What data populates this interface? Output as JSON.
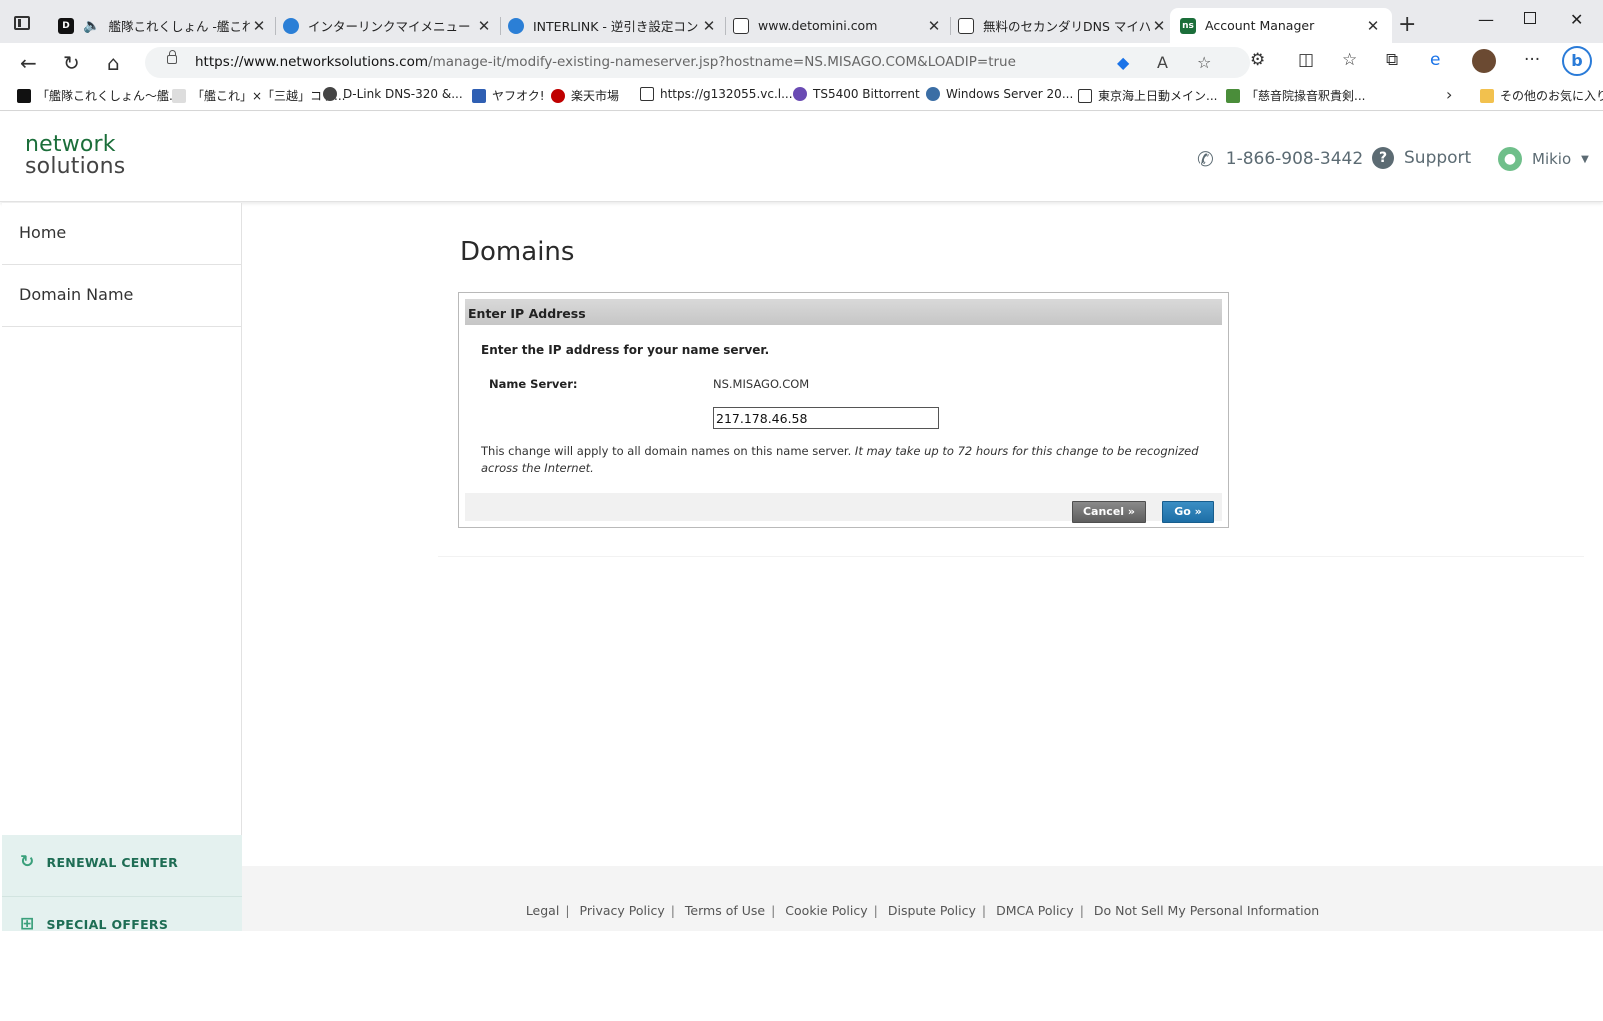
{
  "browser": {
    "tabs": [
      {
        "title": "艦隊これくしょん -艦これ- -",
        "favicon": "dmm-icon",
        "muted": "speaker-icon"
      },
      {
        "title": "インターリンクマイメニュー",
        "favicon": "interlink-icon"
      },
      {
        "title": "INTERLINK - 逆引き設定コントロ",
        "favicon": "interlink-icon"
      },
      {
        "title": "www.detomini.com",
        "favicon": "page-icon"
      },
      {
        "title": "無料のセカンダリDNS マイハマ",
        "favicon": "page-icon"
      },
      {
        "title": "Account Manager",
        "favicon": "ns-icon",
        "favicon_text": "ns",
        "active": true
      }
    ],
    "url_host": "https://www.networksolutions.com",
    "url_path": "/manage-it/modify-existing-nameserver.jsp?hostname=NS.MISAGO.COM&LOADIP=true",
    "bookmarks": [
      "「艦隊これくしょん〜艦...",
      "「艦これ」×「三越」コラ...",
      "D-Link DNS-320 &...",
      "ヤフオク!",
      "楽天市場",
      "https://g132055.vc.l...",
      "TS5400 Bittorrent",
      "Windows Server 20...",
      "東京海上日動メイン...",
      "「慈音院掾音釈貴剣...",
      "その他のお気に入り"
    ]
  },
  "header": {
    "logo_line1": "network",
    "logo_line2": "solutions",
    "phone": "1-866-908-3442",
    "support": "Support",
    "user": "Mikio"
  },
  "sidebar": {
    "items": [
      {
        "label": "Home"
      },
      {
        "label": "Domain Name"
      }
    ],
    "bottom_links": [
      {
        "label": "RENEWAL CENTER",
        "icon": "refresh-icon"
      },
      {
        "label": "SPECIAL OFFERS",
        "icon": "gift-icon"
      }
    ]
  },
  "main": {
    "title": "Domains",
    "panel": {
      "heading": "Enter IP Address",
      "instruction": "Enter the IP address for your name server.",
      "name_server_label": "Name Server:",
      "name_server_value": "NS.MISAGO.COM",
      "ip_value": "217.178.46.58",
      "note_plain": "This change will apply to all domain names on this name server.",
      "note_italic": "It may take up to 72 hours for this change to be recognized across the Internet.",
      "cancel_label": "Cancel »",
      "go_label": "Go »"
    }
  },
  "footer": {
    "links": [
      "Legal",
      "Privacy Policy",
      "Terms of Use",
      "Cookie Policy",
      "Dispute Policy",
      "DMCA Policy",
      "Do Not Sell My Personal Information"
    ]
  },
  "colors": {
    "brand_green": "#1b6e3a",
    "go_blue": "#1d6ea6",
    "sidebar_bottom": "#e4f1ef"
  }
}
